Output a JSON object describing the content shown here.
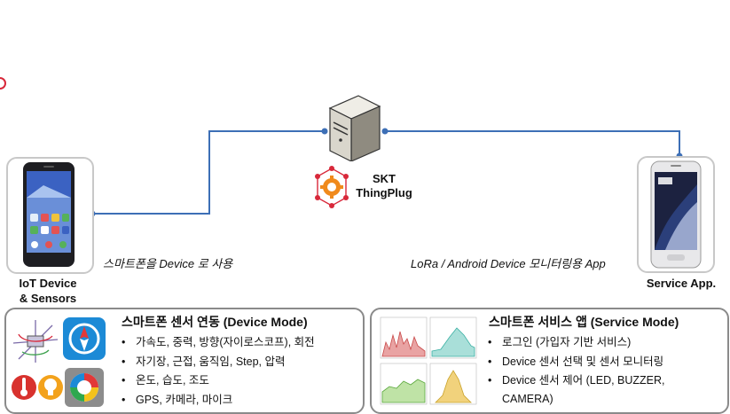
{
  "nodes": {
    "iot_device": {
      "caption_line1": "IoT Device",
      "caption_line2": "& Sensors"
    },
    "platform": {
      "line1": "SKT",
      "line2": "ThingPlug"
    },
    "service_app": {
      "caption": "Service App."
    }
  },
  "edge_labels": {
    "left": "스마트폰을 Device 로 사용",
    "right": "LoRa / Android Device 모니터링용 App"
  },
  "device_panel": {
    "title": "스마트폰 센서 연동 (Device Mode)",
    "items": [
      "가속도, 중력, 방향(자이로스코프), 회전",
      "자기장, 근접, 움직임, Step, 압력",
      "온도, 습도, 조도",
      "GPS, 카메라, 마이크"
    ],
    "icons": [
      "axes-icon",
      "compass-icon",
      "thermometer-icon",
      "light-bulb-icon",
      "camera-icon"
    ]
  },
  "service_panel": {
    "title": "스마트폰 서비스 앱 (Service Mode)",
    "items": [
      "로그인 (가입자 기반 서비스)",
      "Device 센서 선택 및 센서 모니터링",
      "Device 센서 제어 (LED, BUZZER,",
      "CAMERA)"
    ]
  },
  "colors": {
    "connector": "#3d6fb6",
    "panel_border": "#8a8a8a",
    "thingplug_orange": "#f08a1c",
    "thingplug_red": "#d8283a"
  }
}
